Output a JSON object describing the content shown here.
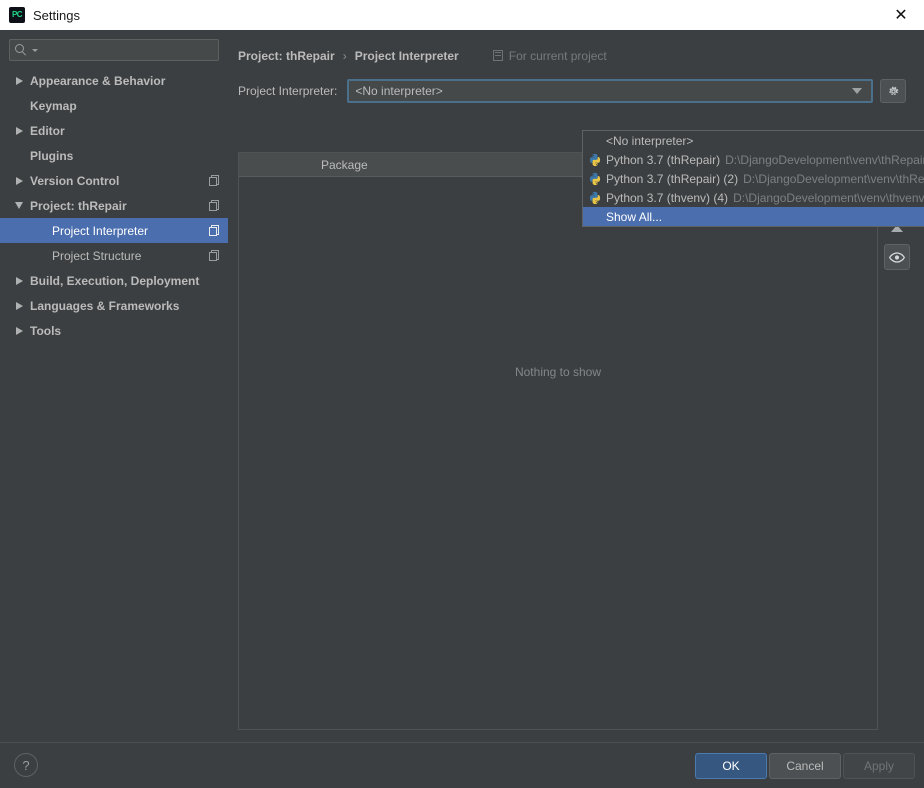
{
  "window": {
    "title": "Settings",
    "app_icon": "pycharm-icon",
    "close_icon": "close-icon"
  },
  "sidebar": {
    "search": {
      "value": "",
      "placeholder": "",
      "icon": "search-icon"
    },
    "items": [
      {
        "label": "Appearance & Behavior",
        "expandable": true,
        "expanded": false,
        "level": 0,
        "bold": true,
        "selected": false,
        "module_icon": false
      },
      {
        "label": "Keymap",
        "expandable": false,
        "expanded": false,
        "level": 0,
        "bold": true,
        "selected": false,
        "module_icon": false
      },
      {
        "label": "Editor",
        "expandable": true,
        "expanded": false,
        "level": 0,
        "bold": true,
        "selected": false,
        "module_icon": false
      },
      {
        "label": "Plugins",
        "expandable": false,
        "expanded": false,
        "level": 0,
        "bold": true,
        "selected": false,
        "module_icon": false
      },
      {
        "label": "Version Control",
        "expandable": true,
        "expanded": false,
        "level": 0,
        "bold": true,
        "selected": false,
        "module_icon": true
      },
      {
        "label": "Project: thRepair",
        "expandable": true,
        "expanded": true,
        "level": 0,
        "bold": true,
        "selected": false,
        "module_icon": true
      },
      {
        "label": "Project Interpreter",
        "expandable": false,
        "expanded": false,
        "level": 1,
        "bold": false,
        "selected": true,
        "module_icon": true
      },
      {
        "label": "Project Structure",
        "expandable": false,
        "expanded": false,
        "level": 1,
        "bold": false,
        "selected": false,
        "module_icon": true
      },
      {
        "label": "Build, Execution, Deployment",
        "expandable": true,
        "expanded": false,
        "level": 0,
        "bold": true,
        "selected": false,
        "module_icon": false
      },
      {
        "label": "Languages & Frameworks",
        "expandable": true,
        "expanded": false,
        "level": 0,
        "bold": true,
        "selected": false,
        "module_icon": false
      },
      {
        "label": "Tools",
        "expandable": true,
        "expanded": false,
        "level": 0,
        "bold": true,
        "selected": false,
        "module_icon": false
      }
    ]
  },
  "content": {
    "breadcrumb": {
      "root": "Project: thRepair",
      "separator": "›",
      "leaf": "Project Interpreter"
    },
    "scope_hint": {
      "label": "For current project",
      "icon": "project-module-icon"
    },
    "interpreter": {
      "label": "Project Interpreter:",
      "selected_value": "<No interpreter>",
      "dropdown_open": true,
      "arrow_icon": "chevron-down-icon",
      "gear_icon": "gear-icon",
      "options": [
        {
          "name": "<No interpreter>",
          "path": "",
          "icon": null,
          "highlighted": false
        },
        {
          "name": "Python 3.7 (thRepair)",
          "path": "D:\\DjangoDevelopment\\venv\\thRepair\\Scripts\\python.exe",
          "icon": "python-venv-icon",
          "highlighted": false
        },
        {
          "name": "Python 3.7 (thRepair) (2)",
          "path": "D:\\DjangoDevelopment\\venv\\thRepair\\Scripts\\python.exe",
          "icon": "python-venv-icon",
          "highlighted": false
        },
        {
          "name": "Python 3.7 (thvenv) (4)",
          "path": "D:\\DjangoDevelopment\\venv\\thvenv\\Scripts\\python.exe",
          "icon": "python-venv-icon",
          "highlighted": false
        },
        {
          "name": "Show All...",
          "path": "",
          "icon": null,
          "highlighted": true
        }
      ]
    },
    "packages": {
      "columns": [
        "Package"
      ],
      "rows": [],
      "empty_text": "Nothing to show"
    },
    "toolbar": [
      {
        "icon": "plus-icon",
        "name": "install-package-button",
        "framed": false
      },
      {
        "icon": "minus-icon",
        "name": "uninstall-package-button",
        "framed": false
      },
      {
        "icon": "upgrade-icon",
        "name": "upgrade-package-button",
        "framed": false
      },
      {
        "icon": "eye-icon",
        "name": "show-early-releases-button",
        "framed": true
      }
    ]
  },
  "footer": {
    "help_label": "?",
    "ok_label": "OK",
    "cancel_label": "Cancel",
    "apply_label": "Apply",
    "apply_enabled": false
  },
  "colors": {
    "window_bg": "#3c3f41",
    "selection_blue": "#4b6eaf",
    "ok_button": "#365880",
    "combo_focus_border": "#4a708b",
    "text_primary": "#bbbbbb",
    "text_muted": "#7c8082"
  }
}
